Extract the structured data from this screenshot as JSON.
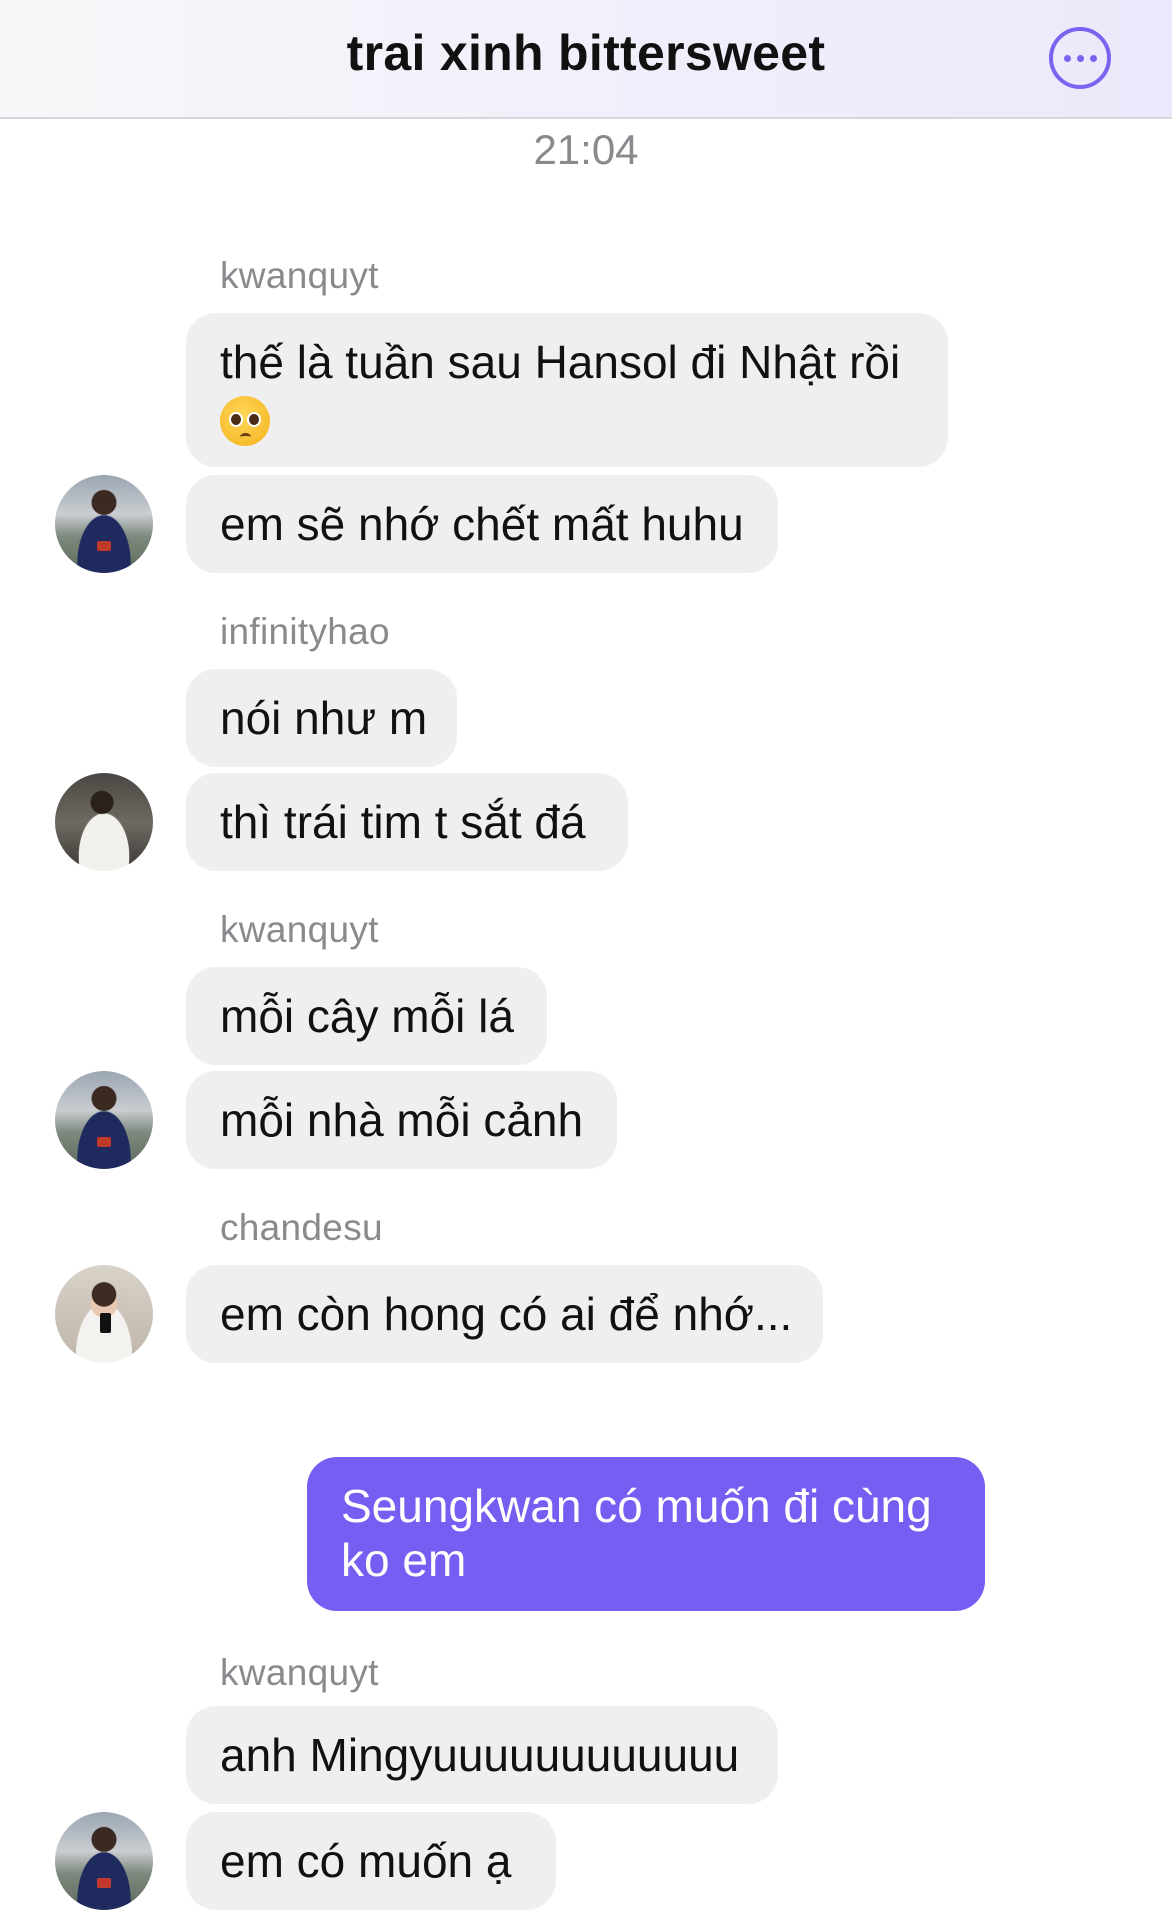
{
  "header": {
    "title": "trai xinh bittersweet"
  },
  "chat": {
    "timestamp": "21:04",
    "groups": [
      {
        "sender": "kwanquyt",
        "messages": [
          "thế là tuần sau Hansol đi Nhật rồi",
          "em sẽ nhớ chết mất huhu"
        ]
      },
      {
        "sender": "infinityhao",
        "messages": [
          "nói như m",
          "thì trái tim t sắt đá"
        ]
      },
      {
        "sender": "kwanquyt",
        "messages": [
          "mỗi cây mỗi lá",
          "mỗi nhà mỗi cảnh"
        ]
      },
      {
        "sender": "chandesu",
        "messages": [
          "em còn hong có ai để nhớ..."
        ]
      },
      {
        "sender": "",
        "outgoing": true,
        "messages": [
          "Seungkwan có muốn đi cùng ko em"
        ]
      },
      {
        "sender": "kwanquyt",
        "messages": [
          "anh Mingyuuuuuuuuuuuu",
          "em có muốn ạ"
        ]
      }
    ]
  },
  "colors": {
    "outgoing_bubble": "#775ef2",
    "incoming_bubble": "#efeff1",
    "accent": "#7b63f0"
  },
  "icons": {
    "more": "more-horizontal-icon",
    "emoji": "pleading-face-emoji"
  }
}
